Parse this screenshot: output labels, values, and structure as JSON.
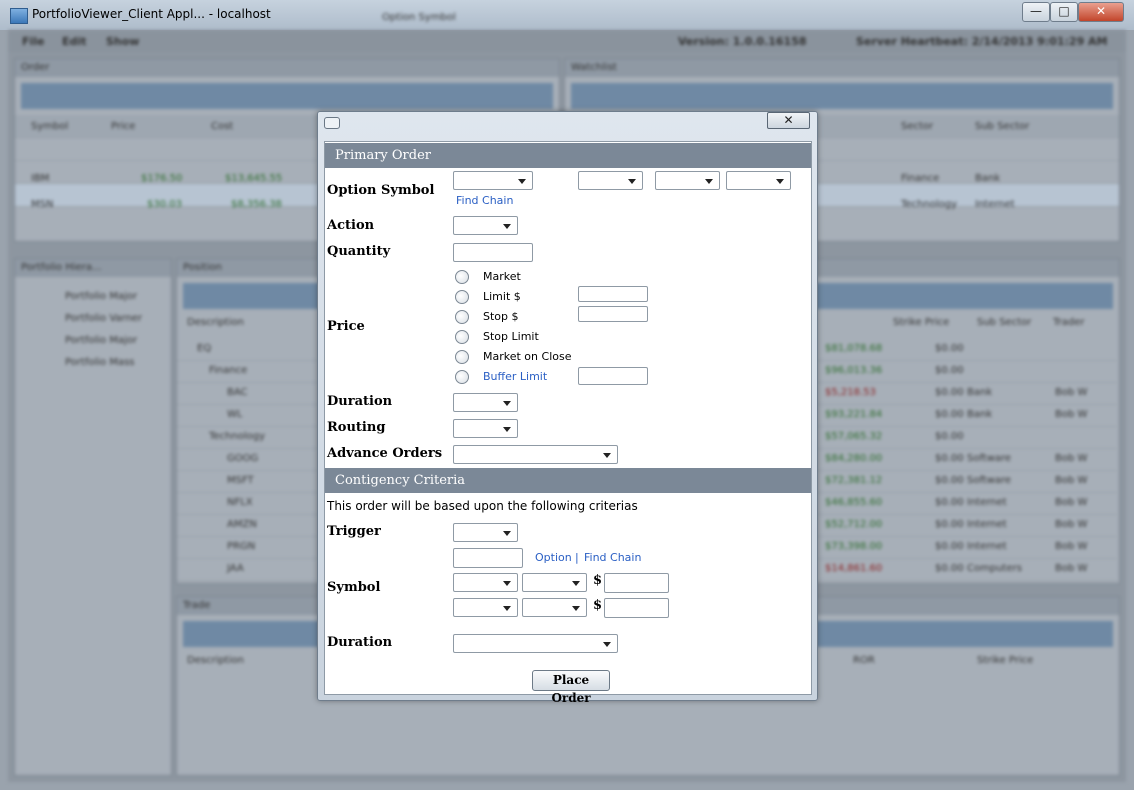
{
  "window": {
    "title": "PortfolioViewer_Client Appl... - localhost",
    "minimize": "—",
    "maximize": "□",
    "close": "✕"
  },
  "background": {
    "menu": [
      "File",
      "Edit",
      "Show"
    ],
    "top_title": "Option Symbol",
    "version": "Version: 1.0.0.16158",
    "heartbeat": "Server Heartbeat: 2/14/2013 9:01:29 AM",
    "order_panel": "Order",
    "watchlist_panel": "Watchlist",
    "portfolio_panel": "Portfolio Hiera...",
    "position_panel": "Position",
    "trade_panel": "Trade",
    "order_columns": [
      "Symbol",
      "Price",
      "Cost"
    ],
    "order_rows": [
      [
        "IBM",
        "$176.50",
        "$13,645.55"
      ],
      [
        "MSN",
        "$30.03",
        "$8,356.38"
      ]
    ],
    "watch_columns": [
      "Sector",
      "Sub Sector"
    ],
    "watch_rows": [
      [
        "Finance",
        "Bank"
      ],
      [
        "Technology",
        "Internet"
      ]
    ],
    "tree_items": [
      "Portfolio Major",
      "Portfolio Varner",
      "Portfolio Major",
      "Portfolio Mass"
    ],
    "position_columns": [
      "Description",
      "Strike Price",
      "Sub Sector",
      "Trader"
    ],
    "position_rows": [
      {
        "name": "EQ",
        "value": "$81,078.68",
        "strike": "$0.00",
        "sub": "",
        "trader": ""
      },
      {
        "name": "Finance",
        "value": "$96,013.36",
        "strike": "$0.00",
        "sub": "",
        "trader": ""
      },
      {
        "name": "BAC",
        "value": "$5,218.53",
        "strike": "$0.00",
        "sub": "Bank",
        "trader": "Bob W"
      },
      {
        "name": "WL",
        "value": "$93,221.84",
        "strike": "$0.00",
        "sub": "Bank",
        "trader": "Bob W"
      },
      {
        "name": "Technology",
        "value": "$57,065.32",
        "strike": "$0.00",
        "sub": "",
        "trader": ""
      },
      {
        "name": "GOOG",
        "value": "$84,280.00",
        "strike": "$0.00",
        "sub": "Software",
        "trader": "Bob W"
      },
      {
        "name": "MSFT",
        "value": "$72,381.12",
        "strike": "$0.00",
        "sub": "Software",
        "trader": "Bob W"
      },
      {
        "name": "NFLX",
        "value": "$46,855.60",
        "strike": "$0.00",
        "sub": "Internet",
        "trader": "Bob W"
      },
      {
        "name": "AMZN",
        "value": "$52,712.00",
        "strike": "$0.00",
        "sub": "Internet",
        "trader": "Bob W"
      },
      {
        "name": "PRGN",
        "value": "$73,398.00",
        "strike": "$0.00",
        "sub": "Internet",
        "trader": "Bob W"
      },
      {
        "name": "JAA",
        "value": "$14,861.60",
        "strike": "$0.00",
        "sub": "Computers",
        "trader": "Bob W"
      }
    ],
    "trade_columns": [
      "Description",
      "ROR",
      "Strike Price"
    ]
  },
  "dialog": {
    "close": "✕",
    "primary_header": "Primary Order",
    "option_symbol_label": "Option Symbol",
    "find_chain": "Find Chain",
    "action_label": "Action",
    "quantity_label": "Quantity",
    "price_label": "Price",
    "price_options": [
      "Market",
      "Limit $",
      "Stop $",
      "Stop Limit",
      "Market on Close",
      "Buffer Limit"
    ],
    "duration_label": "Duration",
    "routing_label": "Routing",
    "advance_orders_label": "Advance Orders",
    "contingency_header": "Contigency Criteria",
    "contingency_note": "This order will be based upon the following criterias",
    "trigger_label": "Trigger",
    "option_link": "Option",
    "link_separator": "|",
    "find_chain2": "Find Chain",
    "symbol_label": "Symbol",
    "dollar": "$",
    "duration2_label": "Duration",
    "place_order": "Place Order"
  },
  "colors": {
    "section_header": "#7b8897",
    "link": "#2a5fc4",
    "dialog_frame": "#c9d3de"
  }
}
